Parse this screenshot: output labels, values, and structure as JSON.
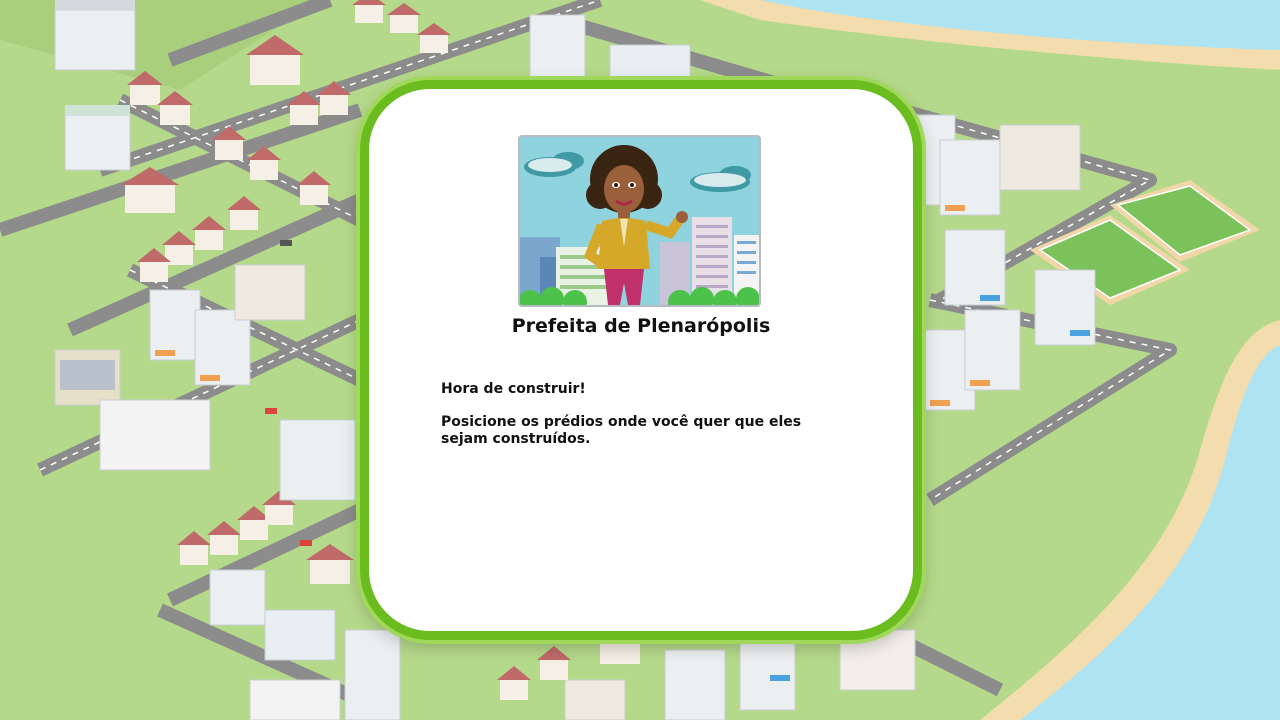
{
  "dialog": {
    "speaker": "Prefeita de Plenarópolis",
    "lines": [
      "Hora de construir!",
      "Posicione os prédios onde você quer que eles sejam construídos."
    ]
  },
  "portrait": {
    "character": "mayor-character",
    "background": "city-skyline"
  },
  "colors": {
    "dialog_border": "#6bbd1f",
    "grass": "#b5d98a",
    "water": "#aee3f2",
    "sand": "#f3dcae",
    "road": "#8c8c8c"
  }
}
